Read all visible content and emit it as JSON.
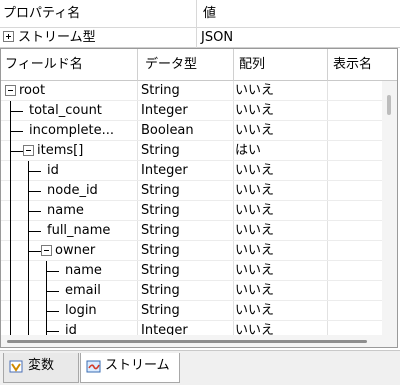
{
  "property_grid": {
    "header_name": "プロパティ名",
    "header_value": "値",
    "rows": [
      {
        "name": "ストリーム型",
        "value": "JSON",
        "expander": "plus"
      }
    ]
  },
  "field_table": {
    "columns": [
      "フィールド名",
      "データ型",
      "配列",
      "表示名"
    ],
    "rows": [
      {
        "name": "root",
        "type": "String",
        "array": "いいえ",
        "display": "",
        "depth": 0,
        "expander": "minus"
      },
      {
        "name": "total_count",
        "type": "Integer",
        "array": "いいえ",
        "display": "",
        "depth": 1,
        "expander": ""
      },
      {
        "name": "incomplete...",
        "type": "Boolean",
        "array": "いいえ",
        "display": "",
        "depth": 1,
        "expander": ""
      },
      {
        "name": "items[]",
        "type": "String",
        "array": "はい",
        "display": "",
        "depth": 1,
        "expander": "minus"
      },
      {
        "name": "id",
        "type": "Integer",
        "array": "いいえ",
        "display": "",
        "depth": 2,
        "expander": ""
      },
      {
        "name": "node_id",
        "type": "String",
        "array": "いいえ",
        "display": "",
        "depth": 2,
        "expander": ""
      },
      {
        "name": "name",
        "type": "String",
        "array": "いいえ",
        "display": "",
        "depth": 2,
        "expander": ""
      },
      {
        "name": "full_name",
        "type": "String",
        "array": "いいえ",
        "display": "",
        "depth": 2,
        "expander": ""
      },
      {
        "name": "owner",
        "type": "String",
        "array": "いいえ",
        "display": "",
        "depth": 2,
        "expander": "minus"
      },
      {
        "name": "name",
        "type": "String",
        "array": "いいえ",
        "display": "",
        "depth": 3,
        "expander": ""
      },
      {
        "name": "email",
        "type": "String",
        "array": "いいえ",
        "display": "",
        "depth": 3,
        "expander": ""
      },
      {
        "name": "login",
        "type": "String",
        "array": "いいえ",
        "display": "",
        "depth": 3,
        "expander": ""
      },
      {
        "name": "id",
        "type": "Integer",
        "array": "いいえ",
        "display": "",
        "depth": 3,
        "expander": ""
      }
    ]
  },
  "tabs": [
    {
      "label": "変数",
      "icon": "variable-icon",
      "active": false
    },
    {
      "label": "ストリーム",
      "icon": "stream-icon",
      "active": true
    }
  ]
}
